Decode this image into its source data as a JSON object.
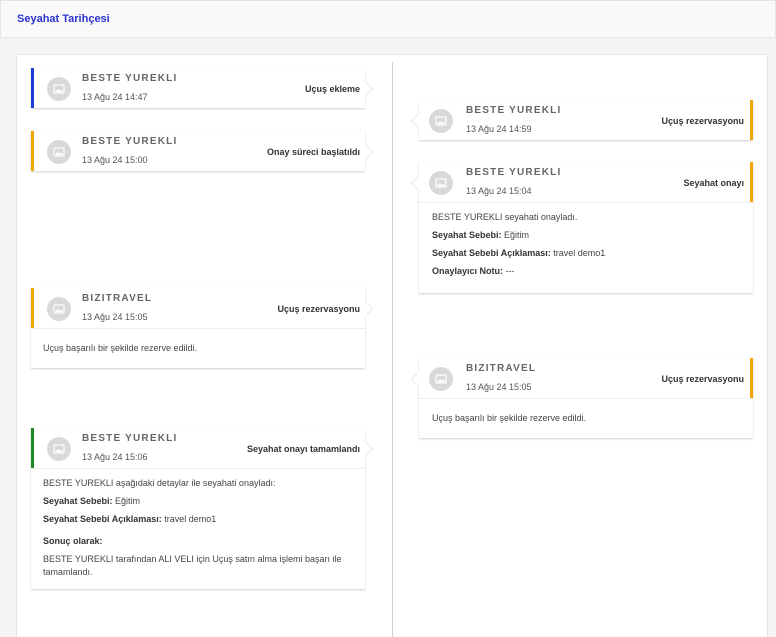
{
  "header": {
    "title": "Seyahat Tarihçesi"
  },
  "colors": {
    "blue": "#1f3bd6",
    "orange": "#f0a500",
    "green": "#1f8a2a"
  },
  "events": [
    {
      "id": "e1",
      "side": "left",
      "author": "BESTE YUREKLI",
      "date": "13 Ağu 24 14:47",
      "action": "Uçuş ekleme",
      "accent": "blue"
    },
    {
      "id": "e2",
      "side": "left",
      "author": "BESTE YUREKLI",
      "date": "13 Ağu 24 15:00",
      "action": "Onay süreci başlatıldı",
      "accent": "orange"
    },
    {
      "id": "e3",
      "side": "right",
      "author": "BESTE YUREKLI",
      "date": "13 Ağu 24 14:59",
      "action": "Uçuş rezervasyonu",
      "accent": "orange"
    },
    {
      "id": "e4",
      "side": "right",
      "author": "BESTE YUREKLI",
      "date": "13 Ağu 24 15:04",
      "action": "Seyahat onayı",
      "accent": "orange",
      "body": {
        "intro": "BESTE YUREKLI seyahati onayladı.",
        "reason_label": "Seyahat Sebebi:",
        "reason_value": "Eğitim",
        "reason_desc_label": "Seyahat Sebebi Açıklaması:",
        "reason_desc_value": "travel demo1",
        "approver_note_label": "Onaylayıcı Notu:",
        "approver_note_value": "---"
      }
    },
    {
      "id": "e5",
      "side": "left",
      "author": "BIZITRAVEL",
      "date": "13 Ağu 24 15:05",
      "action": "Uçuş rezervasyonu",
      "accent": "orange",
      "body": {
        "intro": "Uçuş başarılı bir şekilde rezerve edildi."
      }
    },
    {
      "id": "e6",
      "side": "right",
      "author": "BIZITRAVEL",
      "date": "13 Ağu 24 15:05",
      "action": "Uçuş rezervasyonu",
      "accent": "orange",
      "body": {
        "intro": "Uçuş başarılı bir şekilde rezerve edildi."
      }
    },
    {
      "id": "e7",
      "side": "left",
      "author": "BESTE YUREKLI",
      "date": "13 Ağu 24 15:06",
      "action": "Seyahat onayı tamamlandı",
      "accent": "green",
      "body": {
        "intro": "BESTE YUREKLI aşağıdaki detaylar ile seyahati onayladı:",
        "reason_label": "Seyahat Sebebi:",
        "reason_value": "Eğitim",
        "reason_desc_label": "Seyahat Sebebi Açıklaması:",
        "reason_desc_value": "travel demo1",
        "result_label": "Sonuç olarak:",
        "result_text": "BESTE YUREKLI tarafından ALI VELI için Uçuş satın alma işlemi başarı ile tamamlandı."
      }
    }
  ]
}
